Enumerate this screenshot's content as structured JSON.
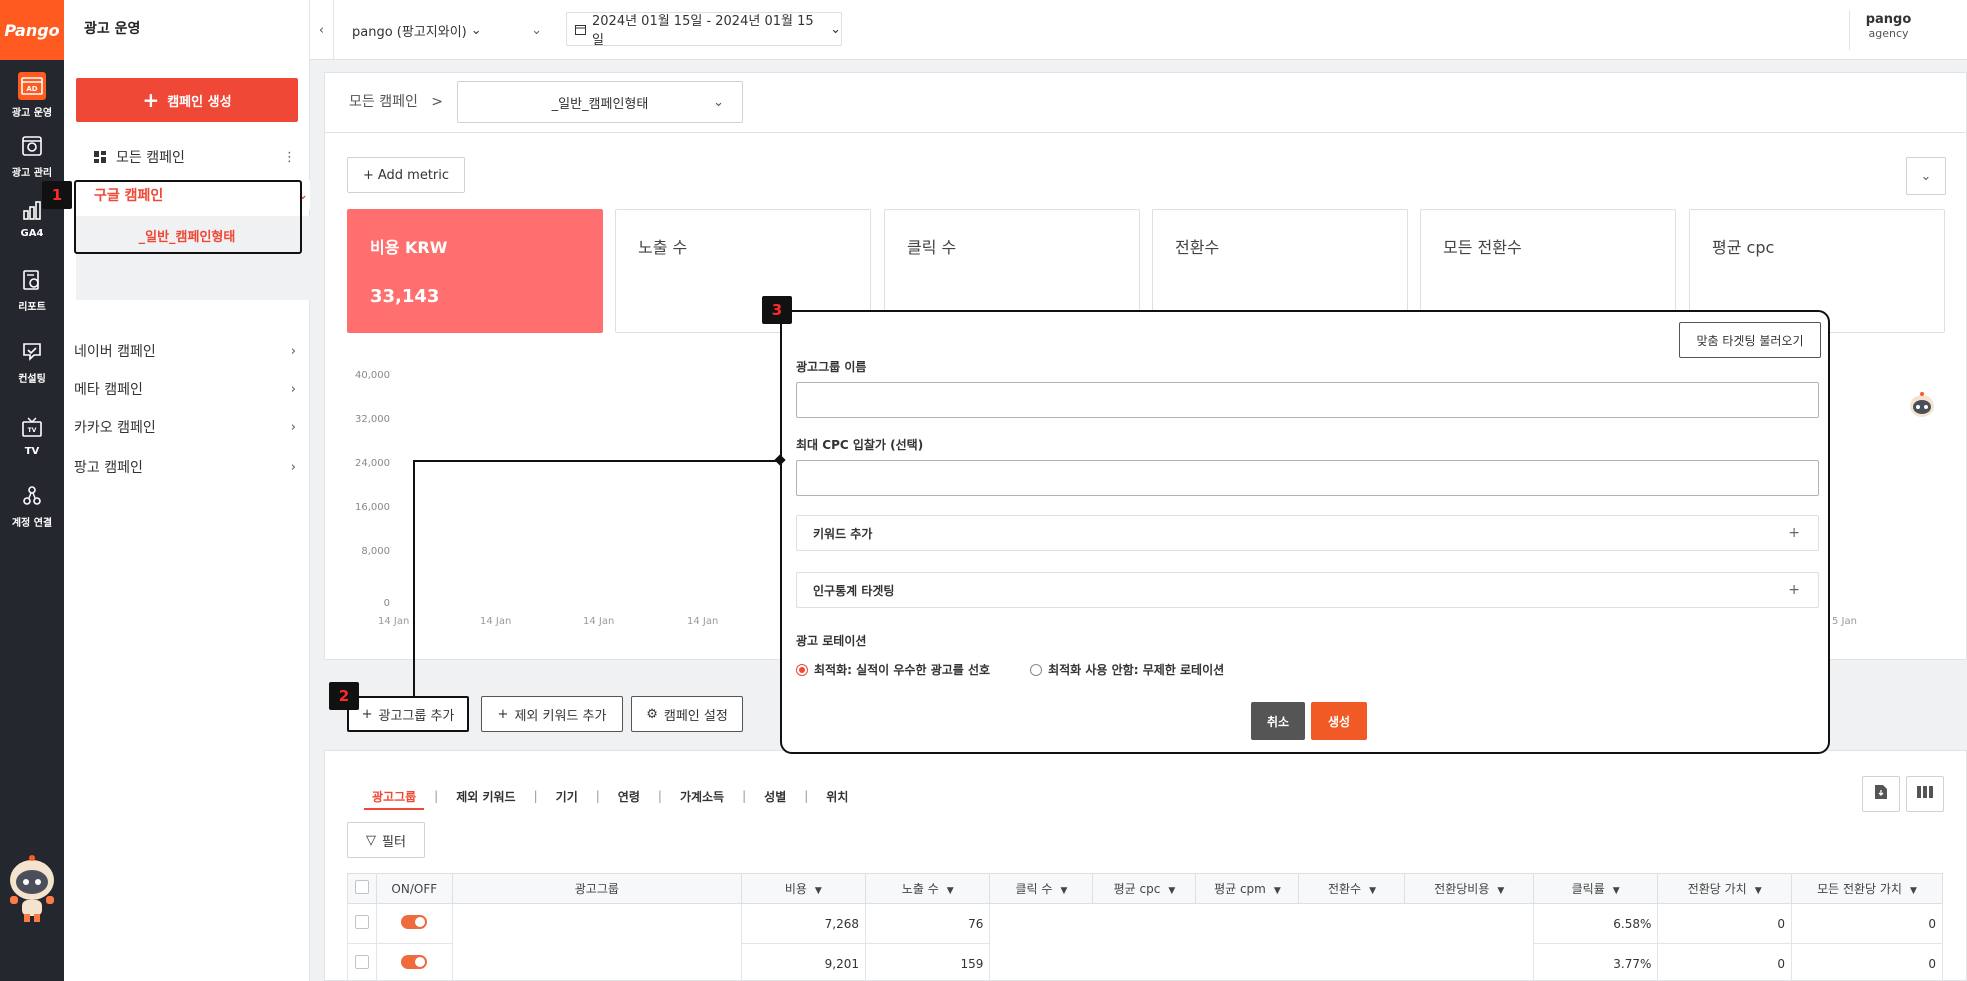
{
  "rail": {
    "logo": "Pango",
    "items": [
      {
        "label": "광고 운영",
        "icon": "ad-icon"
      },
      {
        "label": "광고 관리",
        "icon": "gear-icon"
      },
      {
        "label": "GA4",
        "icon": "bar-chart-icon"
      },
      {
        "label": "리포트",
        "icon": "report-icon"
      },
      {
        "label": "컨설팅",
        "icon": "consulting-icon"
      },
      {
        "label": "TV",
        "icon": "tv-icon"
      },
      {
        "label": "계정 연결",
        "icon": "share-icon"
      }
    ]
  },
  "sidebar": {
    "title": "광고 운영",
    "create_button": "캠페인 생성",
    "all_campaigns": "모든 캠페인",
    "google": "구글 캠페인",
    "google_sub": "_일반_캠페인형태",
    "others": [
      "네이버 캠페인",
      "메타 캠페인",
      "카카오 캠페인",
      "팡고 캠페인"
    ]
  },
  "header": {
    "account": "pango (팡고지와이)",
    "date_range": "2024년 01월 15일 - 2024년 01월 15일",
    "agency_name": "pango",
    "agency_role": "agency"
  },
  "breadcrumb": {
    "root": "모든 캠페인",
    "separator": ">",
    "selected": "_일반_캠페인형태"
  },
  "metrics": {
    "add_metric": "Add metric",
    "cards": [
      {
        "title": "비용 KRW",
        "value": "33,143",
        "active": true
      },
      {
        "title": "노출 수",
        "value": ""
      },
      {
        "title": "클릭 수",
        "value": ""
      },
      {
        "title": "전환수",
        "value": ""
      },
      {
        "title": "모든 전환수",
        "value": ""
      },
      {
        "title": "평균 cpc",
        "value": ""
      }
    ]
  },
  "chart_data": {
    "type": "line",
    "yticks": [
      "40,000",
      "32,000",
      "24,000",
      "16,000",
      "8,000",
      "0"
    ],
    "xticks": [
      "14 Jan",
      "14 Jan",
      "14 Jan",
      "14 Jan",
      "5 Jan"
    ],
    "ylim": [
      0,
      40000
    ]
  },
  "actions": {
    "add_adgroup": "광고그룹 추가",
    "add_negative": "제외 키워드 추가",
    "campaign_settings": "캠페인 설정"
  },
  "tabs": [
    "광고그룹",
    "제외 키워드",
    "기기",
    "연령",
    "가계소득",
    "성별",
    "위치"
  ],
  "filter": "필터",
  "table": {
    "headers": [
      "ON/OFF",
      "광고그룹",
      "비용",
      "노출 수",
      "클릭 수",
      "평균 cpc",
      "평균 cpm",
      "전환수",
      "전환당비용",
      "클릭률",
      "전환당 가치",
      "모든 전환당 가치"
    ],
    "rows": [
      {
        "cost": "7,268",
        "impr": "76",
        "ctr": "6.58%",
        "conv_value": "0",
        "all_conv_value": "0"
      },
      {
        "cost": "9,201",
        "impr": "159",
        "ctr": "3.77%",
        "conv_value": "0",
        "all_conv_value": "0"
      }
    ]
  },
  "modal": {
    "load_targeting": "맞춤 타겟팅 불러오기",
    "name_label": "광고그룹 이름",
    "cpc_label": "최대 CPC 입찰가 (선택)",
    "keyword_add": "키워드 추가",
    "demo_targeting": "인구통계 타겟팅",
    "rotation_label": "광고 로테이션",
    "rotation_opt1": "최적화: 실적이 우수한 광고를 선호",
    "rotation_opt2": "최적화 사용 안함: 무제한 로테이션",
    "cancel": "취소",
    "create": "생성"
  },
  "annotations": [
    "1",
    "2",
    "3"
  ]
}
